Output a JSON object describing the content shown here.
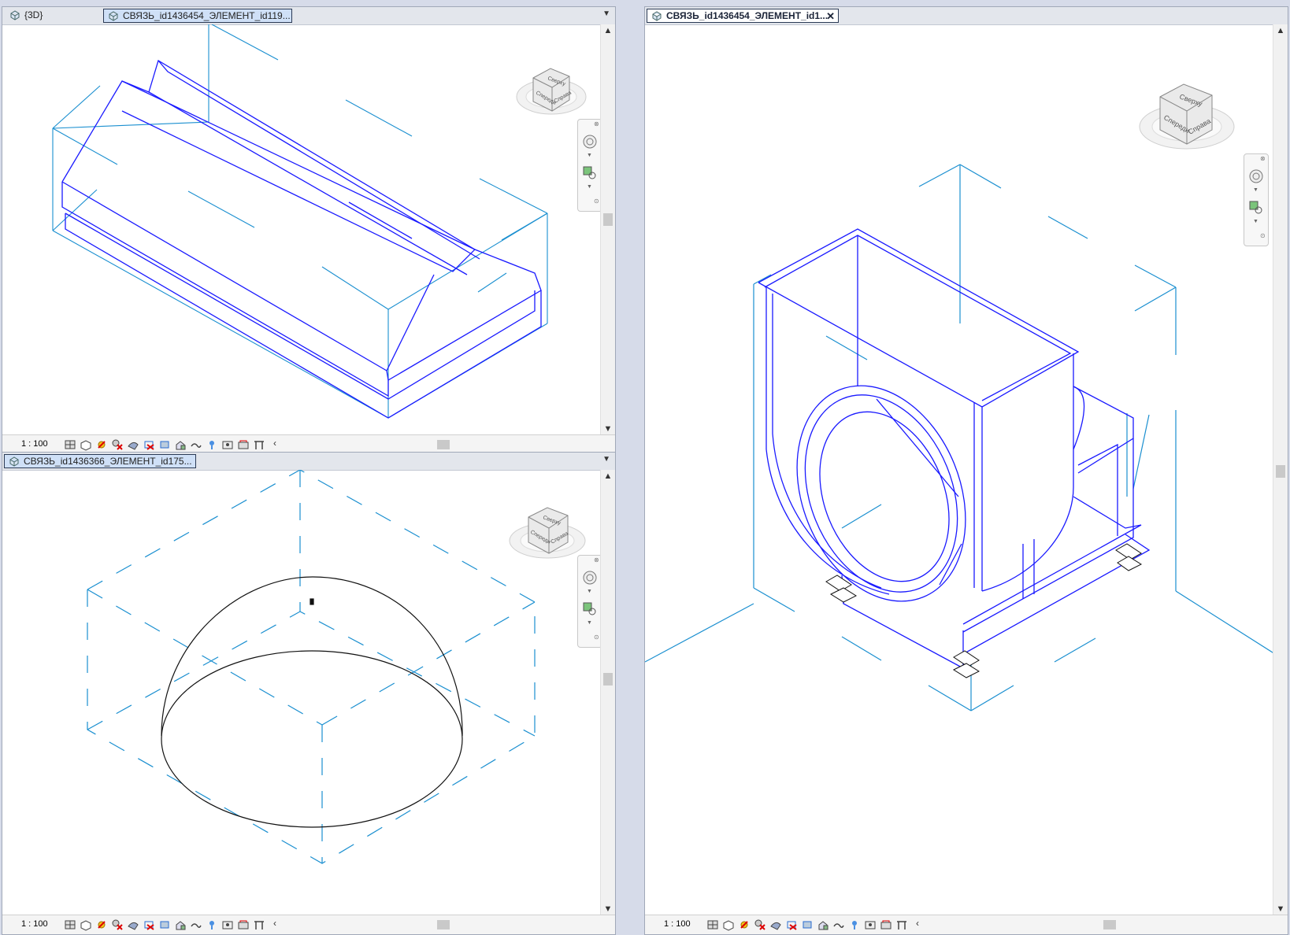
{
  "panes": {
    "top_left": {
      "tabs": [
        {
          "label": "{3D}"
        },
        {
          "label": "СВЯЗЬ_id1436454_ЭЛЕМЕНТ_id119..."
        }
      ],
      "scale": "1 : 100"
    },
    "bottom_left": {
      "tabs": [
        {
          "label": "СВЯЗЬ_id1436366_ЭЛЕМЕНТ_id175..."
        }
      ],
      "scale": "1 : 100"
    },
    "right": {
      "tabs": [
        {
          "label": "СВЯЗЬ_id1436454_ЭЛЕМЕНТ_id1...",
          "close": "✕"
        }
      ],
      "scale": "1 : 100"
    }
  },
  "viewcube": {
    "top": "Сверху",
    "front": "Спереди",
    "right": "Справа"
  },
  "icons": {
    "tab_menu": "chevron-down-icon",
    "view_controls": [
      "detail-level-icon",
      "visual-style-icon",
      "sun-path-icon",
      "shadows-icon",
      "render-icon",
      "crop-icon",
      "show-crop-icon",
      "unlock-3d-icon",
      "temporary-hide-icon",
      "reveal-hidden-icon",
      "temporary-properties-icon",
      "worksharing-icon",
      "analytical-icon"
    ]
  },
  "colors": {
    "model_line": "#1a1aff",
    "bbox_line": "#1a8fd0",
    "accent": "#2b3a55"
  }
}
